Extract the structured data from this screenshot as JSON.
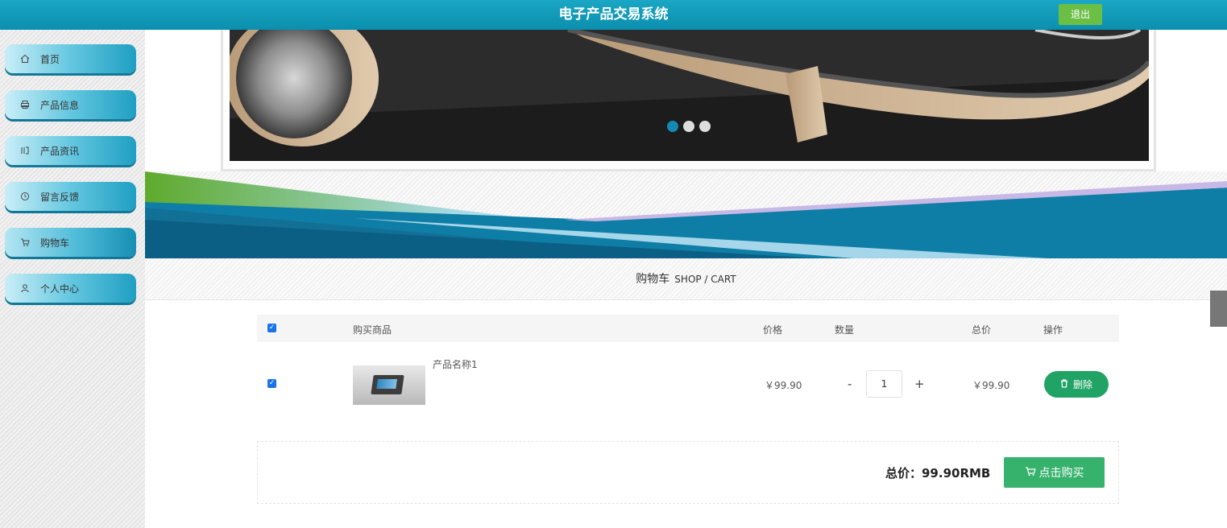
{
  "header": {
    "title": "电子产品交易系统",
    "logout_label": "退出"
  },
  "sidebar": {
    "items": [
      {
        "label": "首页",
        "icon": "home-icon"
      },
      {
        "label": "产品信息",
        "icon": "printer-icon"
      },
      {
        "label": "产品资讯",
        "icon": "news-icon"
      },
      {
        "label": "留言反馈",
        "icon": "clock-icon"
      },
      {
        "label": "购物车",
        "icon": "cart-icon",
        "active": true
      },
      {
        "label": "个人中心",
        "icon": "user-icon"
      }
    ]
  },
  "carousel": {
    "dots": 3,
    "active_dot": 1
  },
  "breadcrumb": {
    "title": "购物车",
    "subtitle": "SHOP / CART"
  },
  "cart": {
    "headers": {
      "product": "购买商品",
      "price": "价格",
      "quantity": "数量",
      "subtotal": "总价",
      "actions": "操作"
    },
    "items": [
      {
        "name": "产品名称1",
        "price": "￥99.90",
        "quantity": "1",
        "subtotal": "￥99.90",
        "delete_label": "删除",
        "checked": true
      }
    ],
    "qty_minus": "-",
    "qty_plus": "+",
    "total_text": "总价：99.90RMB",
    "buy_label": "点击购买"
  },
  "colors": {
    "header": "#0b8fae",
    "logout": "#6cbf45",
    "delete": "#21a366",
    "buy": "#37b26c",
    "accent_blue": "#1a73e8"
  }
}
